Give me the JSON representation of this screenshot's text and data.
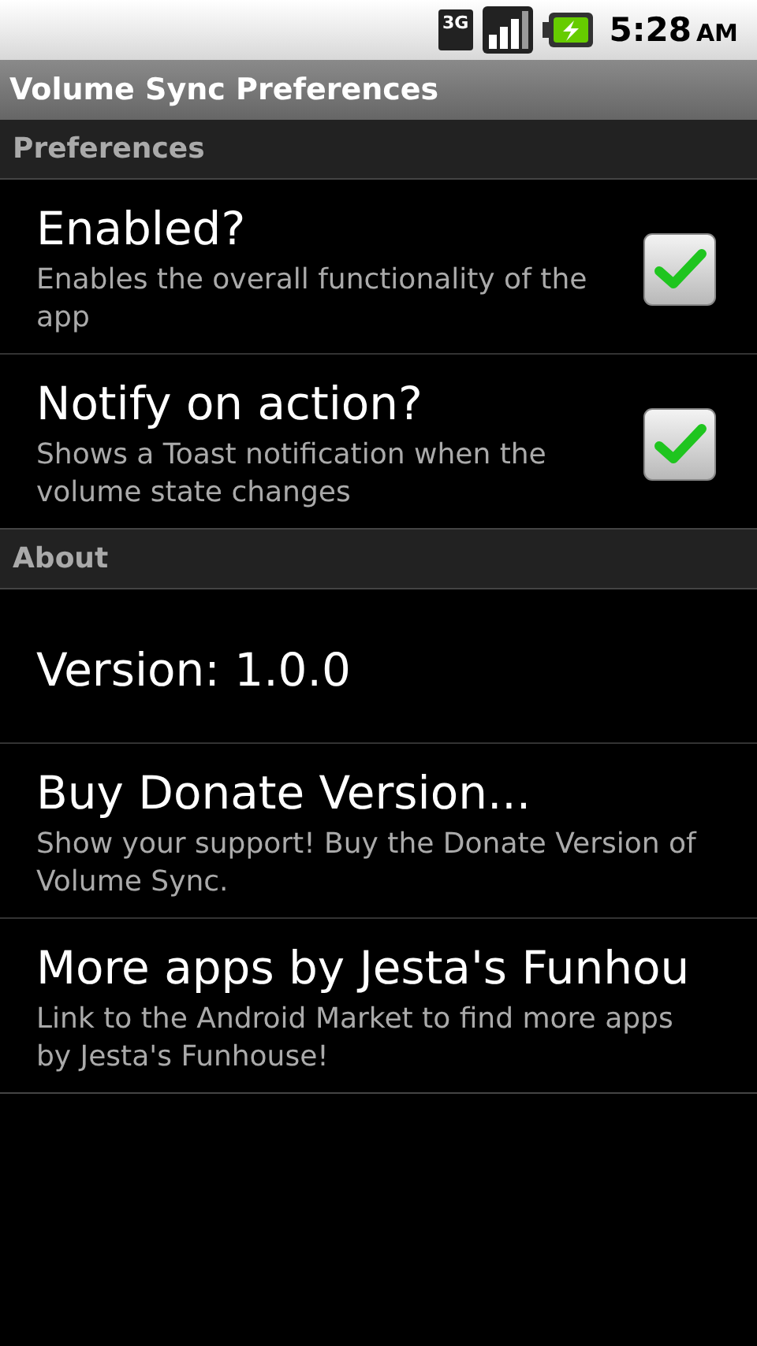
{
  "status_bar": {
    "network": "3G",
    "time": "5:28",
    "ampm": "AM"
  },
  "window": {
    "title": "Volume Sync Preferences"
  },
  "sections": [
    {
      "header": "Preferences",
      "items": [
        {
          "kind": "checkbox",
          "title": "Enabled?",
          "summary": "Enables the overall functionality of the app",
          "checked": true
        },
        {
          "kind": "checkbox",
          "title": "Notify on action?",
          "summary": "Shows a Toast notification when the volume state changes",
          "checked": true
        }
      ]
    },
    {
      "header": "About",
      "items": [
        {
          "kind": "plain",
          "title": "Version: 1.0.0"
        },
        {
          "kind": "plain",
          "title": "Buy Donate Version...",
          "summary": "Show your support! Buy the Donate Version of Volume Sync."
        },
        {
          "kind": "plain",
          "title": "More apps by Jesta's Funhou",
          "summary": "Link to the Android Market to find more apps by Jesta's Funhouse!"
        }
      ]
    }
  ]
}
